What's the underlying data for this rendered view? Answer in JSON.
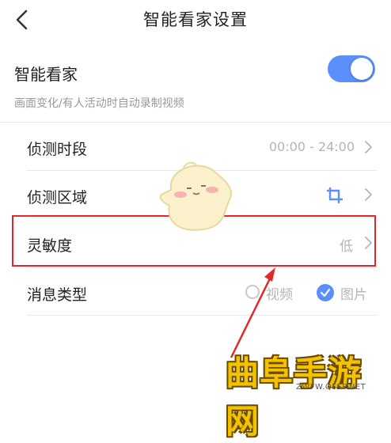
{
  "header": {
    "title": "智能看家设置"
  },
  "main_toggle": {
    "label": "智能看家",
    "enabled": true,
    "description": "画面变化/有人活动时自动录制视频"
  },
  "settings": {
    "schedule": {
      "label": "侦测时段",
      "value": "00:00 - 24:00"
    },
    "area": {
      "label": "侦测区域",
      "icon": "crop-icon"
    },
    "sensitivity": {
      "label": "灵敏度",
      "value": "低"
    },
    "message_type": {
      "label": "消息类型",
      "options": [
        "视频",
        "图片"
      ],
      "selected": "图片"
    }
  },
  "watermark": {
    "text": "曲阜手游网",
    "url": "ZWFW.QFSP.NET"
  },
  "colors": {
    "accent": "#5b8ff9",
    "highlight": "#e02a2a",
    "watermark": "#f2c200"
  }
}
